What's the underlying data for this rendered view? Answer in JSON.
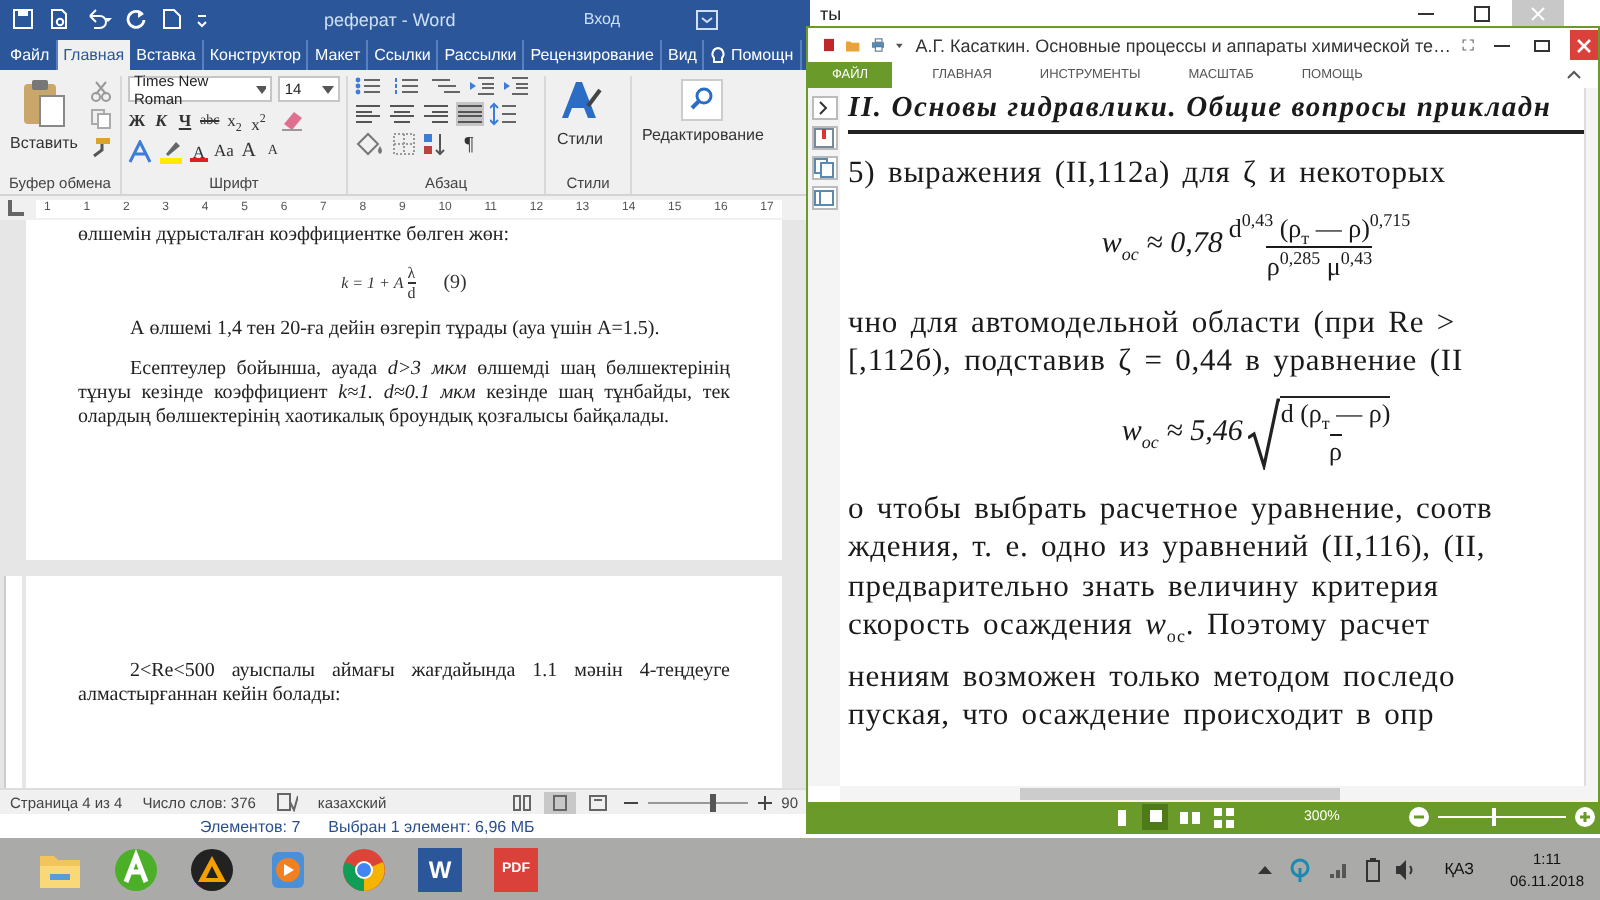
{
  "explorer": {
    "title": "ты",
    "items": "Элементов: 7",
    "selection": "Выбран 1 элемент: 6,96 МБ"
  },
  "word": {
    "title": "реферат - Word",
    "sign_in": "Вход",
    "tabs": [
      {
        "label": "Файл",
        "selected": false
      },
      {
        "label": "Главная",
        "selected": true
      },
      {
        "label": "Вставка",
        "selected": false
      },
      {
        "label": "Конструктор",
        "selected": false
      },
      {
        "label": "Макет",
        "selected": false
      },
      {
        "label": "Ссылки",
        "selected": false
      },
      {
        "label": "Рассылки",
        "selected": false
      },
      {
        "label": "Рецензирование",
        "selected": false
      },
      {
        "label": "Вид",
        "selected": false
      },
      {
        "label": "Помощн",
        "selected": false
      }
    ],
    "clipboard": {
      "paste": "Вставить",
      "group": "Буфер обмена"
    },
    "font": {
      "name": "Times New Roman",
      "size": "14",
      "row1": [
        "Ж",
        "К",
        "Ч",
        "abc",
        "x$_{2}$",
        "x$^{2}$"
      ],
      "row2": [
        "A",
        "Aa",
        "A",
        "A"
      ],
      "group": "Шрифт"
    },
    "paragraph": {
      "align": [
        {
          "selected": false
        },
        {
          "selected": false
        },
        {
          "selected": false
        },
        {
          "selected": true
        }
      ],
      "pilcrow": "¶",
      "group": "Абзац"
    },
    "styles": {
      "button": "Стили",
      "group": "Стили"
    },
    "editing": {
      "button": "Редактирование"
    },
    "ruler": [
      "1",
      "1",
      "2",
      "3",
      "4",
      "5",
      "6",
      "7",
      "8",
      "9",
      "10",
      "11",
      "12",
      "13",
      "14",
      "15",
      "16",
      "17"
    ],
    "page1": [
      {
        "kind": "text",
        "text": "өлшемін дұрысталған коэффициентке бөлген жөн:"
      },
      {
        "kind": "formula",
        "lhs": "k = 1 + A",
        "num": "λ",
        "den": "d",
        "tag": "(9)"
      },
      {
        "kind": "para",
        "text": "А өлшемі 1,4 тен 20-ға дейін өзгеріп тұрады (ауа үшін А=1.5)."
      },
      {
        "kind": "para",
        "text": "Есептеулер бойынша, ауада *d>3 мкм* өлшемді шаң бөлшектерінің тұнуы кезінде коэффициент *k≈1. d≈0.1 мкм* кезінде шаң тұнбайды, тек олардың бөлшектерінің хаотикалық броундық қозғалысы байқалады."
      }
    ],
    "page2": [
      {
        "kind": "para",
        "text": "2<Re<500 ауыспалы аймағы жағдайында 1.1 мәнін 4-теңдеуге алмастырғаннан кейін болады:"
      }
    ],
    "status": {
      "page": "Страница 4 из 4",
      "words": "Число слов: 376",
      "language": "казахский",
      "views": [
        {
          "selected": false
        },
        {
          "selected": true
        },
        {
          "selected": false
        }
      ],
      "level": 0.62,
      "zoom": "90"
    }
  },
  "pdf": {
    "title": "А.Г. Касаткин. Основные процессы и аппараты химической те…",
    "tabs": [
      {
        "label": "ФАЙЛ",
        "selected": true
      },
      {
        "label": "ГЛАВНАЯ",
        "selected": false
      },
      {
        "label": "ИНСТРУМЕНТЫ",
        "selected": false
      },
      {
        "label": "МАСШТАБ",
        "selected": false
      },
      {
        "label": "ПОМОЩЬ",
        "selected": false
      }
    ],
    "header": "II. Основы гидравлики. Общие вопросы прикладн",
    "lines": [
      {
        "kind": "line",
        "text": "5) выражения (II,112а) для ζ и некоторых"
      },
      {
        "kind": "frac",
        "lhs": "w$_{ос}$ ≈ 0,78",
        "num": "d$^{0,43}$ (ρ$_{т}$ — ρ)$^{0,715}$",
        "den": "ρ$^{0,285}$ μ$^{0,43}$"
      },
      {
        "kind": "line",
        "text": "чно для автомодельной области (при Re >"
      },
      {
        "kind": "line",
        "text": "[,112б), подставив ζ = 0,44 в уравнение (II"
      },
      {
        "kind": "root",
        "lhs": "w$_{ос}$ ≈ 5,46",
        "num": "d (ρ$_{т}$ — ρ)",
        "den": "ρ"
      },
      {
        "kind": "line",
        "text": "о чтобы выбрать расчетное уравнение, соотв"
      },
      {
        "kind": "line",
        "text": "ждения, т. е. одно из уравнений (II,116), (II,"
      },
      {
        "kind": "line",
        "text": "предварительно знать величину критерия"
      },
      {
        "kind": "line",
        "text": "скорость осаждения *w*$_{ос}$. Поэтому расчет"
      },
      {
        "kind": "line",
        "text": "нениям возможен только методом последо"
      },
      {
        "kind": "line",
        "text": "пуская, что осаждение происходит в опр"
      }
    ],
    "views": [
      {
        "selected": false
      },
      {
        "selected": true
      },
      {
        "selected": false
      },
      {
        "selected": false
      }
    ],
    "zoom": "300%",
    "level": 0.42
  },
  "taskbar": {
    "apps": [
      {
        "kind": "folder"
      },
      {
        "kind": "green"
      },
      {
        "kind": "cone"
      },
      {
        "kind": "player"
      },
      {
        "kind": "browser"
      },
      {
        "kind": "word",
        "label": "W"
      },
      {
        "kind": "pdf",
        "label": "PDF"
      }
    ],
    "tray": {
      "lang": "ҚАЗ",
      "time": "1:11",
      "date": "06.11.2018"
    }
  }
}
